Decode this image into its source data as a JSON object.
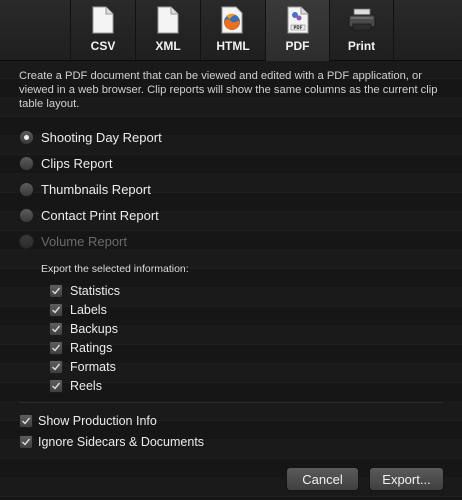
{
  "toolbar": {
    "items": [
      {
        "label": "CSV",
        "icon": "csv-file-icon",
        "selected": false
      },
      {
        "label": "XML",
        "icon": "xml-file-icon",
        "selected": false
      },
      {
        "label": "HTML",
        "icon": "html-firefox-icon",
        "selected": false
      },
      {
        "label": "PDF",
        "icon": "pdf-file-icon",
        "selected": true
      },
      {
        "label": "Print",
        "icon": "printer-icon",
        "selected": false
      }
    ]
  },
  "description": "Create a PDF document that can be viewed and edited with a PDF application, or viewed in a web browser. Clip reports will show the same columns as the current clip table layout.",
  "reports": [
    {
      "label": "Shooting Day Report",
      "selected": true,
      "disabled": false
    },
    {
      "label": "Clips Report",
      "selected": false,
      "disabled": false
    },
    {
      "label": "Thumbnails Report",
      "selected": false,
      "disabled": false
    },
    {
      "label": "Contact Print Report",
      "selected": false,
      "disabled": false
    },
    {
      "label": "Volume Report",
      "selected": false,
      "disabled": true
    }
  ],
  "export_section_label": "Export the selected information:",
  "export_options": [
    {
      "label": "Statistics",
      "checked": true
    },
    {
      "label": "Labels",
      "checked": true
    },
    {
      "label": "Backups",
      "checked": true
    },
    {
      "label": "Ratings",
      "checked": true
    },
    {
      "label": "Formats",
      "checked": true
    },
    {
      "label": "Reels",
      "checked": true
    }
  ],
  "options": [
    {
      "label": "Show Production Info",
      "checked": true
    },
    {
      "label": "Ignore Sidecars & Documents",
      "checked": true
    }
  ],
  "buttons": {
    "cancel": "Cancel",
    "export": "Export..."
  }
}
